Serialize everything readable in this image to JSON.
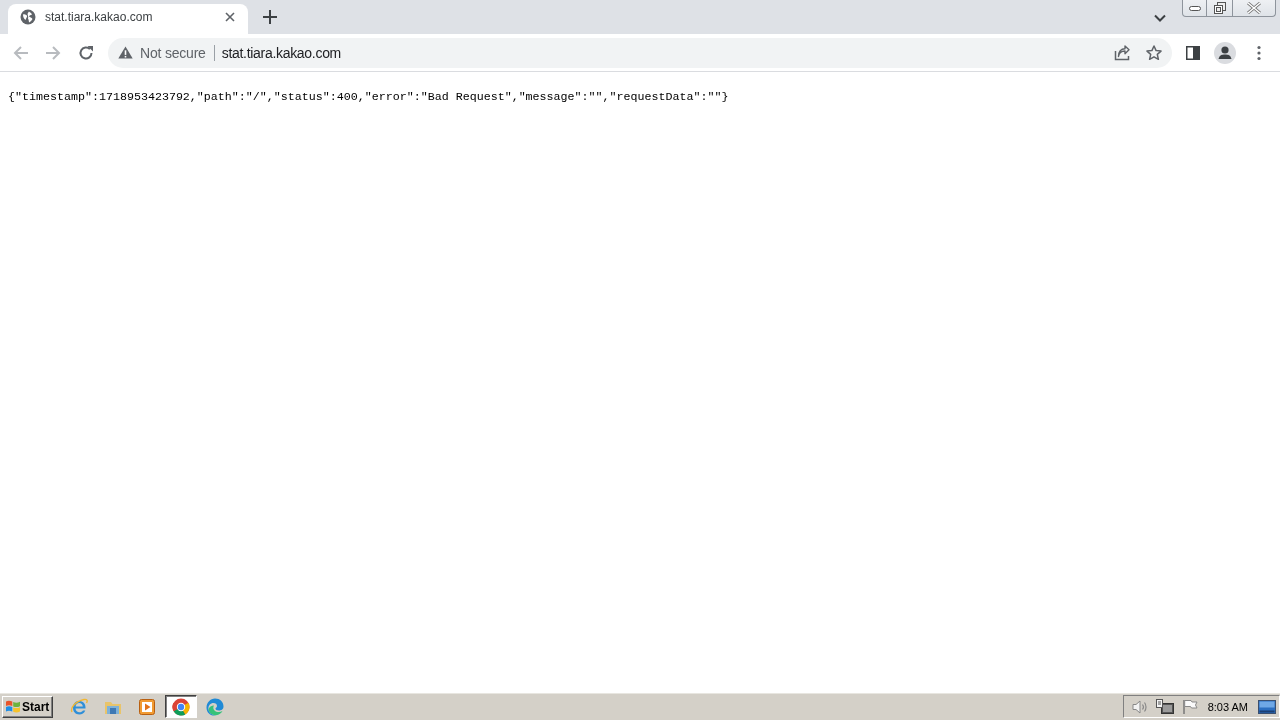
{
  "tabs": [
    {
      "title": "stat.tiara.kakao.com",
      "selected": true
    }
  ],
  "nav_buttons": [
    {
      "kind": "back",
      "disabled": true
    },
    {
      "kind": "forward",
      "disabled": true
    },
    {
      "kind": "reload",
      "disabled": false
    }
  ],
  "address_bar": {
    "security_label": "Not secure",
    "url": "stat.tiara.kakao.com"
  },
  "page": {
    "text": "{\"timestamp\":1718953423792,\"path\":\"/\",\"status\":400,\"error\":\"Bad Request\",\"message\":\"\",\"requestData\":\"\"}"
  },
  "taskbar": {
    "start_label": "Start",
    "apps": [
      {
        "kind": "ie",
        "selected": false
      },
      {
        "kind": "explorer",
        "selected": false
      },
      {
        "kind": "media",
        "selected": false
      },
      {
        "kind": "chrome",
        "selected": true
      },
      {
        "kind": "edge",
        "selected": false
      }
    ],
    "clock": "8:03 AM"
  }
}
